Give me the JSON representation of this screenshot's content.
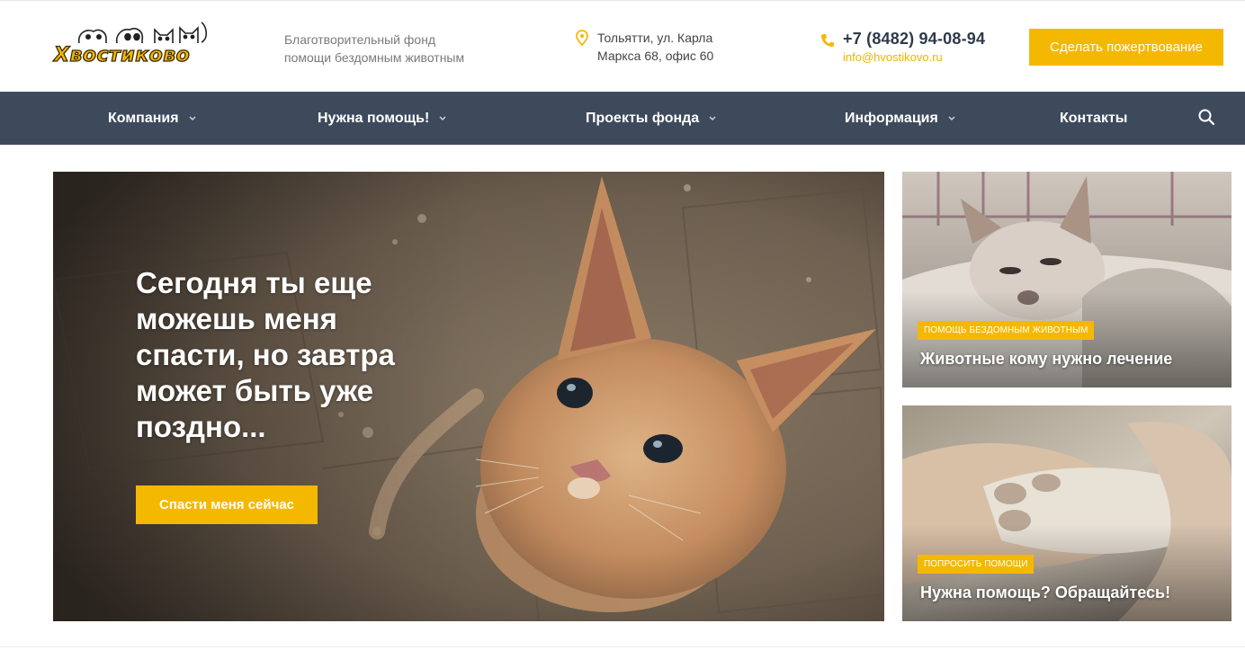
{
  "header": {
    "logo_text": "Хвостиково",
    "tagline_line1": "Благотворительный фонд",
    "tagline_line2": "помощи бездомным животным",
    "address_line1": "Тольятти, ул. Карла",
    "address_line2": "Маркса 68, офис 60",
    "phone": "+7 (8482) 94-08-94",
    "email": "info@hvostikovo.ru",
    "donate_label": "Сделать пожертвование"
  },
  "nav": {
    "items": [
      {
        "label": "Компания"
      },
      {
        "label": "Нужна помощь!"
      },
      {
        "label": "Проекты фонда"
      },
      {
        "label": "Информация"
      },
      {
        "label": "Контакты"
      }
    ]
  },
  "hero": {
    "title": "Сегодня ты еще можешь меня спасти, но завтра может быть уже поздно...",
    "button_label": "Спасти меня сейчас"
  },
  "cards": [
    {
      "badge": "Помощь бездомным животным",
      "title": "Животные кому нужно лечение"
    },
    {
      "badge": "Попросить помощи",
      "title": "Нужна помощь? Обращайтесь!"
    }
  ],
  "colors": {
    "accent": "#f5b800",
    "nav_bg": "#3d4a5c",
    "phone": "#2f3a48"
  },
  "icons": [
    "map-pin-icon",
    "phone-icon",
    "chevron-down-icon",
    "search-icon"
  ]
}
